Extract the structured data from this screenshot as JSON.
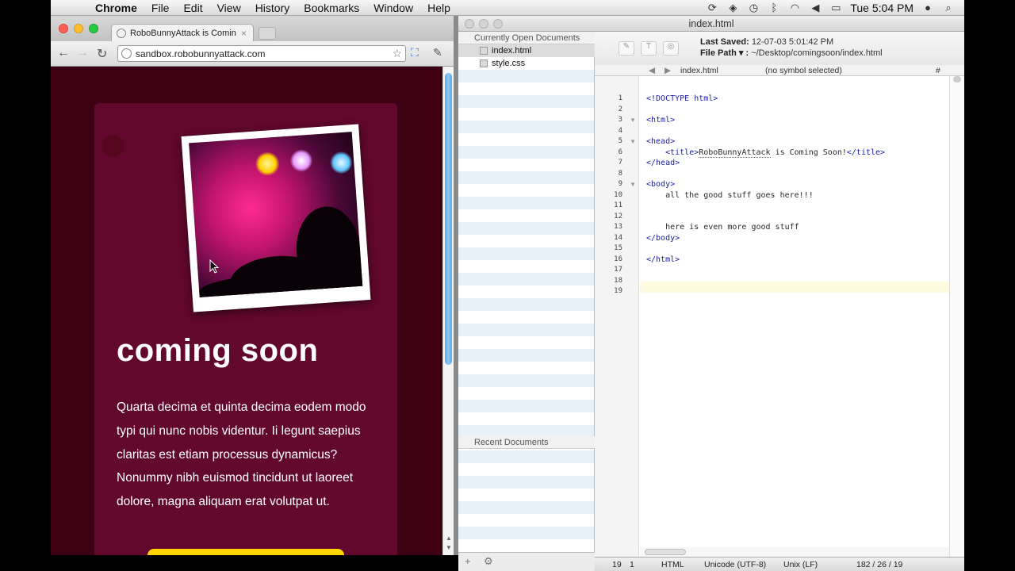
{
  "menubar": {
    "app": "Chrome",
    "items": [
      "File",
      "Edit",
      "View",
      "History",
      "Bookmarks",
      "Window",
      "Help"
    ],
    "clock": "Tue 5:04 PM"
  },
  "browser": {
    "tab_title": "RoboBunnyAttack is Coming",
    "url": "sandbox.robobunnyattack.com",
    "page": {
      "headline": "coming soon",
      "body": "Quarta decima et quinta decima eodem modo typi qui nunc nobis videntur. Ii legunt saepius claritas est etiam processus dynamicus? Nonummy nibh euismod tincidunt ut laoreet dolore, magna aliquam erat volutpat ut."
    }
  },
  "editor": {
    "window_title": "index.html",
    "sidebar": {
      "open_header": "Currently Open Documents",
      "files": [
        "index.html",
        "style.css"
      ],
      "recent_header": "Recent Documents"
    },
    "last_saved_label": "Last Saved:",
    "last_saved_value": "12-07-03 5:01:42 PM",
    "file_path_label": "File Path ▾ :",
    "file_path_value": "~/Desktop/comingsoon/index.html",
    "nav_file": "index.html",
    "nav_symbol": "(no symbol selected)",
    "nav_hash": "#",
    "lines": [
      "<!DOCTYPE html>",
      "",
      "<html>",
      "",
      "<head>",
      "    <title>RoboBunnyAttack is Coming Soon!</title>",
      "</head>",
      "",
      "<body>",
      "    all the good stuff goes here!!!",
      "",
      "",
      "    here is even more good stuff",
      "</body>",
      "",
      "</html>",
      "",
      "",
      ""
    ],
    "line_numbers": [
      "1",
      "2",
      "3",
      "4",
      "5",
      "6",
      "7",
      "8",
      "9",
      "10",
      "11",
      "12",
      "13",
      "14",
      "15",
      "16",
      "17",
      "18",
      "19"
    ],
    "status": {
      "line": "19",
      "col": "1",
      "language": "HTML",
      "encoding": "Unicode (UTF-8)",
      "line_endings": "Unix (LF)",
      "counts": "182 / 26 / 19"
    }
  }
}
